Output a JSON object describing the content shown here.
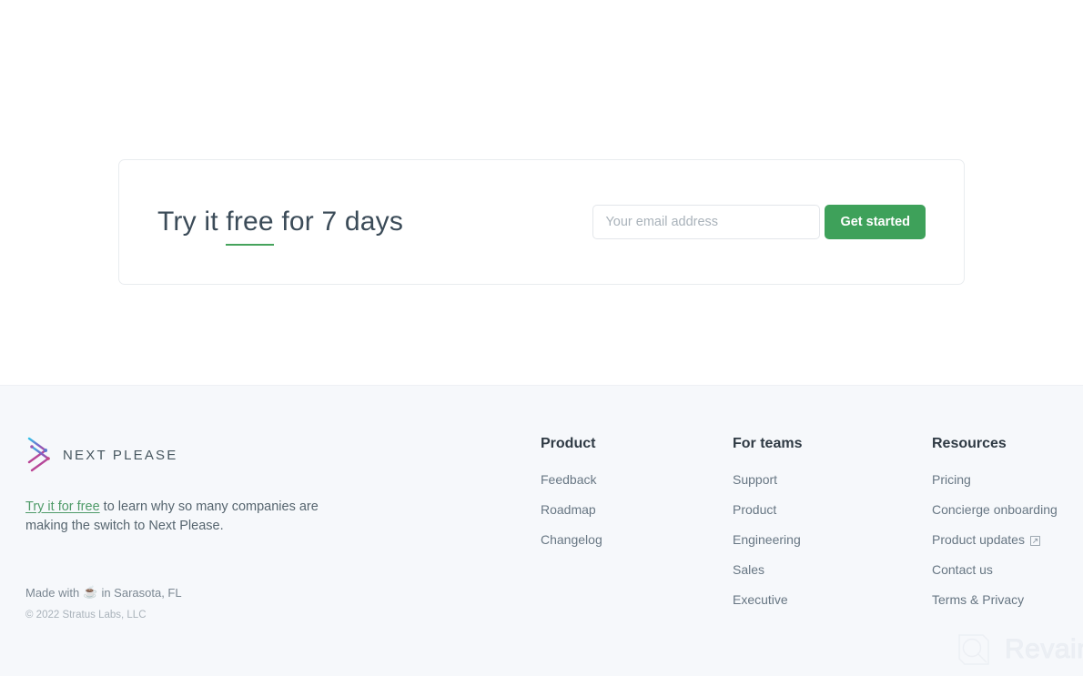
{
  "cta": {
    "heading_before": "Try it ",
    "heading_highlight": "free",
    "heading_after": " for 7 days",
    "email_placeholder": "Your email address",
    "email_value": "",
    "button_label": "Get started",
    "accent_color": "#3ea15a"
  },
  "footer": {
    "brand": {
      "wordmark": "NEXT PLEASE",
      "logo_icon": "next-please-chevron-logo",
      "description_link": "Try it for free",
      "description_rest": " to learn why so many companies are making the switch to Next Please.",
      "made_with_prefix": "Made with",
      "made_with_icon": "coffee-cup-icon",
      "made_with_suffix": "in Sarasota, FL",
      "copyright": "© 2022 Stratus Labs, LLC"
    },
    "columns": [
      {
        "title": "Product",
        "links": [
          {
            "label": "Feedback",
            "external": false
          },
          {
            "label": "Roadmap",
            "external": false
          },
          {
            "label": "Changelog",
            "external": false
          }
        ]
      },
      {
        "title": "For teams",
        "links": [
          {
            "label": "Support",
            "external": false
          },
          {
            "label": "Product",
            "external": false
          },
          {
            "label": "Engineering",
            "external": false
          },
          {
            "label": "Sales",
            "external": false
          },
          {
            "label": "Executive",
            "external": false
          }
        ]
      },
      {
        "title": "Resources",
        "links": [
          {
            "label": "Pricing",
            "external": false
          },
          {
            "label": "Concierge onboarding",
            "external": false
          },
          {
            "label": "Product updates",
            "external": true
          },
          {
            "label": "Contact us",
            "external": false
          },
          {
            "label": "Terms & Privacy",
            "external": false
          }
        ]
      }
    ]
  },
  "watermark": {
    "text": "Revain",
    "icon": "revain-logo-icon"
  }
}
